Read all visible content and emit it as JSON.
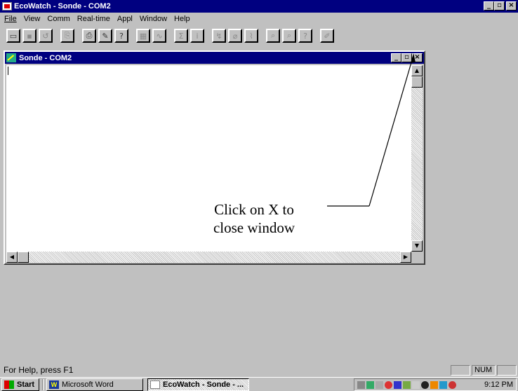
{
  "main_window": {
    "title": "EcoWatch - Sonde - COM2",
    "controls": {
      "minimize": "_",
      "maximize": "▫",
      "close": "×"
    }
  },
  "menu": {
    "items": [
      "File",
      "View",
      "Comm",
      "Real-time",
      "Appl",
      "Window",
      "Help"
    ]
  },
  "toolbar": {
    "buttons": [
      {
        "icon": "open-folder-icon",
        "glyph": "▭"
      },
      {
        "icon": "save-icon",
        "glyph": "▪"
      },
      {
        "icon": "undo-icon",
        "glyph": "↺"
      },
      {
        "icon": "copy-icon",
        "glyph": "⎘"
      },
      {
        "icon": "print-icon",
        "glyph": "⎙"
      },
      {
        "icon": "tools-icon",
        "glyph": "✎"
      },
      {
        "icon": "context-help-icon",
        "glyph": "?"
      },
      {
        "icon": "table-icon",
        "glyph": "▦"
      },
      {
        "icon": "graph-icon",
        "glyph": "∿"
      },
      {
        "icon": "statistics-icon",
        "glyph": "Σ"
      },
      {
        "icon": "info-icon",
        "glyph": "i"
      },
      {
        "icon": "plot-icon",
        "glyph": "↯"
      },
      {
        "icon": "probe-icon",
        "glyph": "⌀"
      },
      {
        "icon": "chart-icon",
        "glyph": "⌇"
      },
      {
        "icon": "search-icon",
        "glyph": "⌕"
      },
      {
        "icon": "search-alt-icon",
        "glyph": "⌕"
      },
      {
        "icon": "help-icon",
        "glyph": "?"
      },
      {
        "icon": "pen-icon",
        "glyph": "✐"
      }
    ]
  },
  "child_window": {
    "title": "Sonde - COM2",
    "controls": {
      "minimize": "_",
      "maximize": "▫",
      "close": "×"
    }
  },
  "annotation": {
    "line1": "Click on X to",
    "line2": "close window"
  },
  "statusbar": {
    "text": "For Help, press F1",
    "num": "NUM"
  },
  "taskbar": {
    "start": "Start",
    "tasks": [
      {
        "label": "Microsoft Word",
        "active": false
      },
      {
        "label": "EcoWatch - Sonde - ...",
        "active": true
      }
    ],
    "clock": "9:12 PM"
  },
  "colors": {
    "titlebar": "#000080",
    "face": "#c0c0c0"
  }
}
